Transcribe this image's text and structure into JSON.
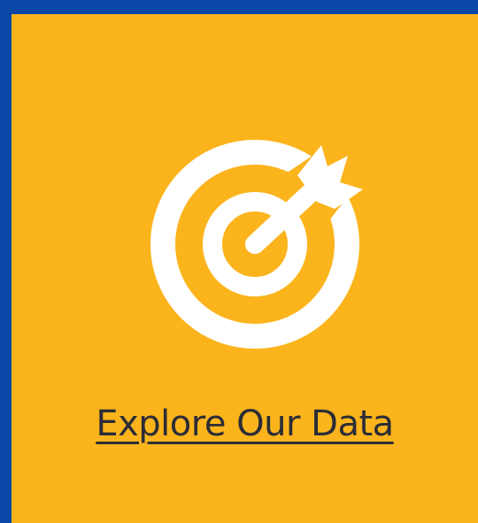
{
  "tile": {
    "link_label": "Explore Our Data",
    "icon": "target-arrow-icon"
  },
  "colors": {
    "page_background": "#0a47a6",
    "tile_background": "#fbb41c",
    "icon_color": "#ffffff",
    "label_color": "#2b2d36"
  }
}
